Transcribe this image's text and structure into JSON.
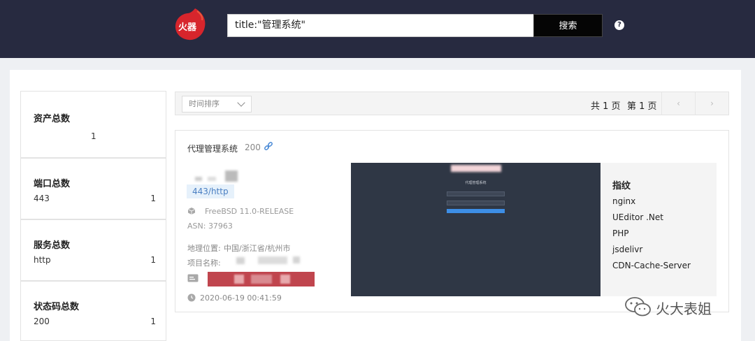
{
  "header": {
    "logo_text": "火器",
    "search_value": "title:\"管理系统\"",
    "search_button": "搜索",
    "help_icon": "help-circle-icon"
  },
  "stats": [
    {
      "title": "资产总数",
      "value": "1"
    },
    {
      "title": "端口总数",
      "label": "443",
      "value": "1"
    },
    {
      "title": "服务总数",
      "label": "http",
      "value": "1"
    },
    {
      "title": "状态码总数",
      "label": "200",
      "value": "1"
    }
  ],
  "toolbar": {
    "sort_label": "时间排序",
    "total_pages": "共 1 页",
    "current_page": "第 1 页",
    "prev": "‹",
    "next": "›"
  },
  "result": {
    "title": "代理管理系统",
    "status_code": "200",
    "port": "443/http",
    "os": "FreeBSD 11.0-RELEASE",
    "asn": "ASN: 37963",
    "location_label": "地理位置:",
    "location_value": "中国/浙江省/杭州市",
    "project_label": "项目名称:",
    "timestamp": "2020-06-19 00:41:59",
    "preview_title": "代理管理系统",
    "fingerprint_title": "指纹",
    "fingerprints": [
      "nginx",
      "UEditor .Net",
      "PHP",
      "jsdelivr",
      "CDN-Cache-Server"
    ]
  },
  "watermark": {
    "text": "火大表姐"
  },
  "colors": {
    "topbar": "#272a40",
    "port_tag_bg": "#e6f1fb",
    "port_tag_text": "#4a7fc2",
    "redacted": "#c0454e"
  }
}
